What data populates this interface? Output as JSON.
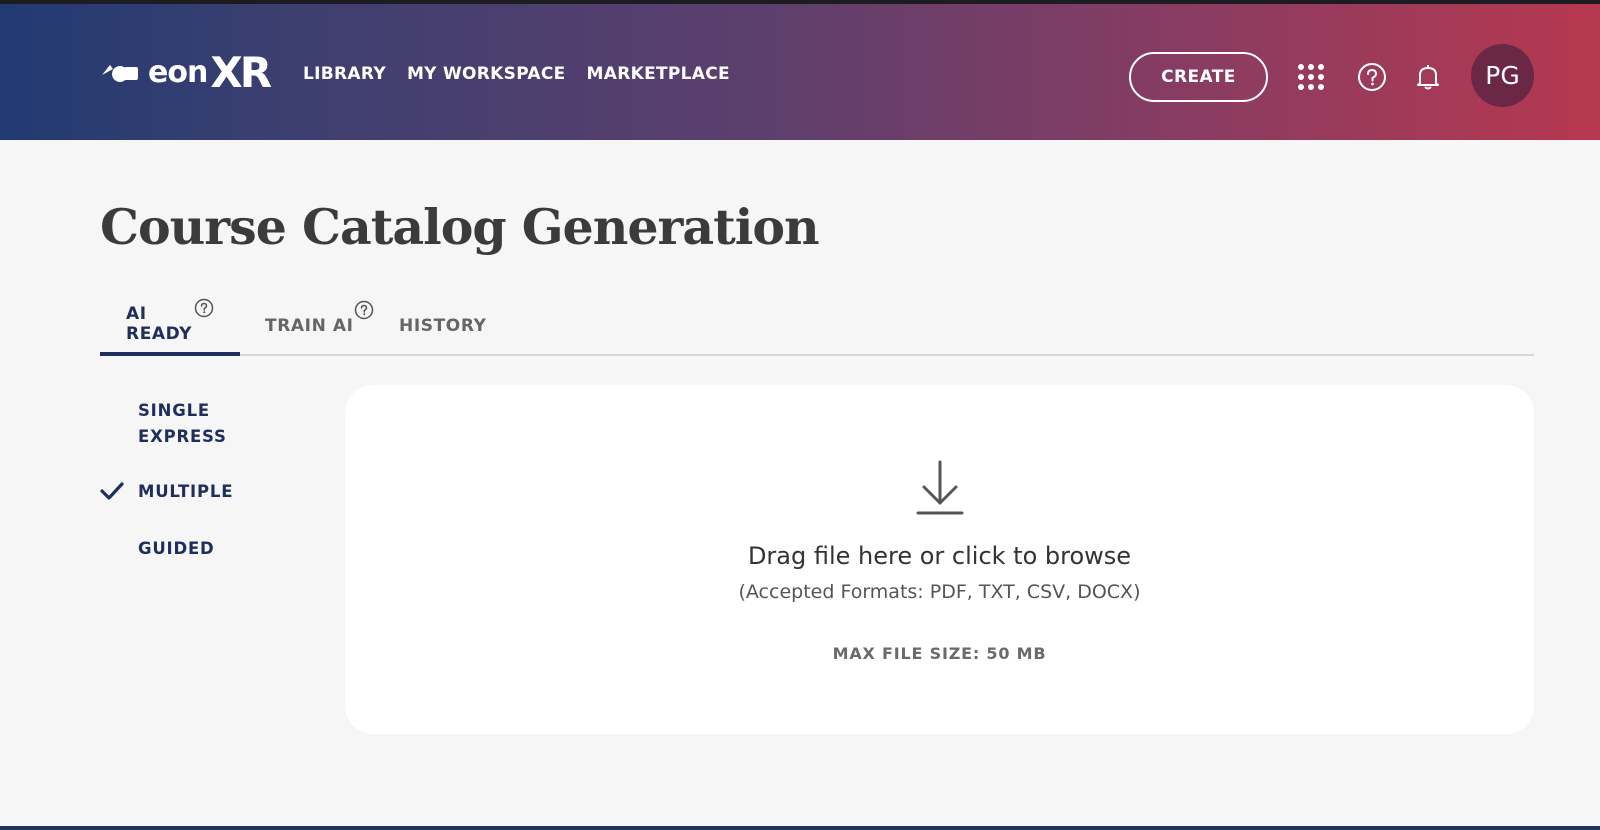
{
  "header": {
    "logo_text": "eon",
    "logo_xr": "XR",
    "nav": [
      "LIBRARY",
      "MY WORKSPACE",
      "MARKETPLACE"
    ],
    "create_label": "CREATE",
    "icons": [
      "apps-grid-icon",
      "help-icon",
      "bell-icon"
    ],
    "avatar_initials": "PG"
  },
  "page": {
    "title": "Course Catalog Generation"
  },
  "tabs": [
    {
      "label": "AI READY",
      "active": true,
      "help_icon": true
    },
    {
      "label": "TRAIN AI",
      "active": false,
      "help_icon": true
    },
    {
      "label": "HISTORY",
      "active": false,
      "help_icon": false
    }
  ],
  "sidebar": {
    "items": [
      {
        "label": "SINGLE EXPRESS",
        "selected": false
      },
      {
        "label": "MULTIPLE",
        "selected": true
      },
      {
        "label": "GUIDED",
        "selected": false
      }
    ]
  },
  "dropzone": {
    "icon": "download-icon",
    "main_text": "Drag file here or click to browse",
    "formats_text": "(Accepted Formats: PDF, TXT, CSV, DOCX)",
    "max_size_text": "MAX FILE SIZE: 50 MB"
  },
  "colors": {
    "accent_navy": "#1e2f5c",
    "header_gradient_start": "#213a72",
    "header_gradient_end": "#b6384f",
    "avatar_bg": "#6a2846"
  }
}
